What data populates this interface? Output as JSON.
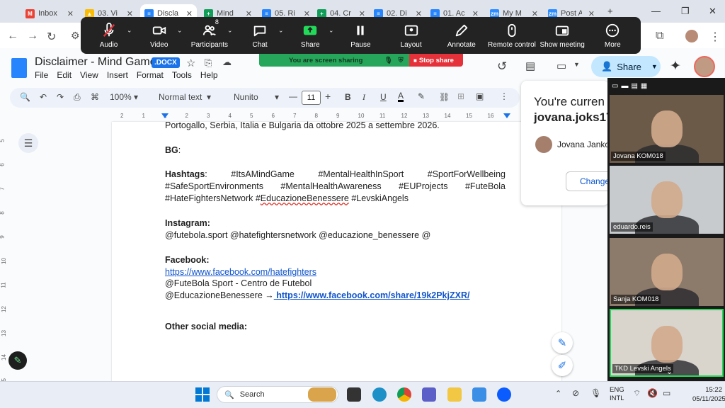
{
  "browser": {
    "tabs": [
      {
        "title": "Inbox",
        "color": "#ea4335",
        "icon": "gmail-icon",
        "glyph": "M"
      },
      {
        "title": "03. Vi",
        "color": "#fbbc04",
        "icon": "drive-icon",
        "glyph": "▲"
      },
      {
        "title": "Discla",
        "color": "#2684fc",
        "icon": "docs-icon",
        "glyph": "≡",
        "active": true
      },
      {
        "title": "Mind",
        "color": "#0f9d58",
        "icon": "sheets-icon",
        "glyph": "+"
      },
      {
        "title": "05. Ri",
        "color": "#2684fc",
        "icon": "docs-icon",
        "glyph": "≡"
      },
      {
        "title": "04. Cr",
        "color": "#0f9d58",
        "icon": "sheets-icon",
        "glyph": "+"
      },
      {
        "title": "02. Di",
        "color": "#2684fc",
        "icon": "docs-icon",
        "glyph": "≡"
      },
      {
        "title": "01. Ac",
        "color": "#2684fc",
        "icon": "docs-icon",
        "glyph": "≡"
      },
      {
        "title": "My M",
        "color": "#2d8cff",
        "icon": "zoom-icon",
        "glyph": "zm"
      },
      {
        "title": "Post A",
        "color": "#2d8cff",
        "icon": "zoom-icon",
        "glyph": "zm"
      }
    ],
    "new_tab": "+"
  },
  "zoom": {
    "buttons": [
      {
        "label": "Audio",
        "icon": "mic-muted-icon"
      },
      {
        "label": "Video",
        "icon": "video-icon"
      },
      {
        "label": "Participants",
        "icon": "participants-icon",
        "badge": "8"
      },
      {
        "label": "Chat",
        "icon": "chat-icon"
      },
      {
        "label": "Share",
        "icon": "share-screen-icon"
      },
      {
        "label": "Pause",
        "icon": "pause-icon"
      },
      {
        "label": "Layout",
        "icon": "layout-icon"
      },
      {
        "label": "Annotate",
        "icon": "annotate-icon"
      },
      {
        "label": "Remote control",
        "icon": "remote-control-icon"
      },
      {
        "label": "Show meeting",
        "icon": "show-meeting-icon"
      },
      {
        "label": "More",
        "icon": "more-icon"
      }
    ],
    "sharing_text": "You are screen sharing",
    "stop_share": "Stop share",
    "participants": [
      {
        "name": "Jovana KOM018",
        "bg": "#6b5a48"
      },
      {
        "name": "eduardo.reis",
        "bg": "#c8cbcd"
      },
      {
        "name": "Sanja KOM018",
        "bg": "#8c7a6a"
      },
      {
        "name": "TKD Levski Angels",
        "bg": "#d9d4cc"
      }
    ]
  },
  "docs": {
    "title": "Disclaimer - Mind Game",
    "badge": ".DOCX",
    "menu": [
      "File",
      "Edit",
      "View",
      "Insert",
      "Format",
      "Tools",
      "Help"
    ],
    "share_label": "Share",
    "toolbar": {
      "zoom": "100%",
      "style": "Normal text",
      "font": "Nunito",
      "font_size": "11"
    },
    "ruler_h": [
      "2",
      "1",
      "1",
      "2",
      "3",
      "4",
      "5",
      "6",
      "7",
      "8",
      "9",
      "10",
      "11",
      "12",
      "13",
      "14",
      "15",
      "16"
    ],
    "ruler_v": [
      "5",
      "6",
      "7",
      "8",
      "9",
      "10",
      "11",
      "12",
      "13",
      "14",
      "15"
    ],
    "content": {
      "intro": "Portogallo, Serbia, Italia e Bulgaria da ottobre 2025 a settembre 2026.",
      "bg_label": "BG",
      "bg_colon": ":",
      "hashtags_label": "Hashtags",
      "hashtags_colon": ":",
      "hashtags_line1": [
        "#ItsAMindGame",
        "#MentalHealthInSport",
        "#SportForWellbeing"
      ],
      "hashtags_line2": [
        "#SafeSportEnvironments",
        "#MentalHealthAwareness",
        "#EUProjects",
        "#FuteBola"
      ],
      "hashtags_line3_a": "#HateFightersNetwork #",
      "hashtags_line3_b": "EducazioneBenessere",
      "hashtags_line3_c": " #LevskiAngels",
      "instagram_label": "Instagram:",
      "instagram_text": "@futebola.sport @hatefightersnetwork @educazione_benessere @",
      "facebook_label": "Facebook:",
      "facebook_link": "https://www.facebook.com/hatefighters",
      "facebook_line2": "@FuteBola Sport - Centro de Futebol",
      "facebook_line3_a": " @EducazioneBenessere →",
      "facebook_line3_link": " https://www.facebook.com/share/19k2PkjZXR/",
      "other_label": "Other social media:"
    },
    "presence": {
      "line1": "You're curren",
      "line2": "jovana.joks17",
      "user": "Jovana Janko",
      "change": "Change"
    }
  },
  "taskbar": {
    "search": "Search",
    "lang1": "ENG",
    "lang2": "INTL",
    "time": "15:22",
    "date": "05/11/2025"
  }
}
